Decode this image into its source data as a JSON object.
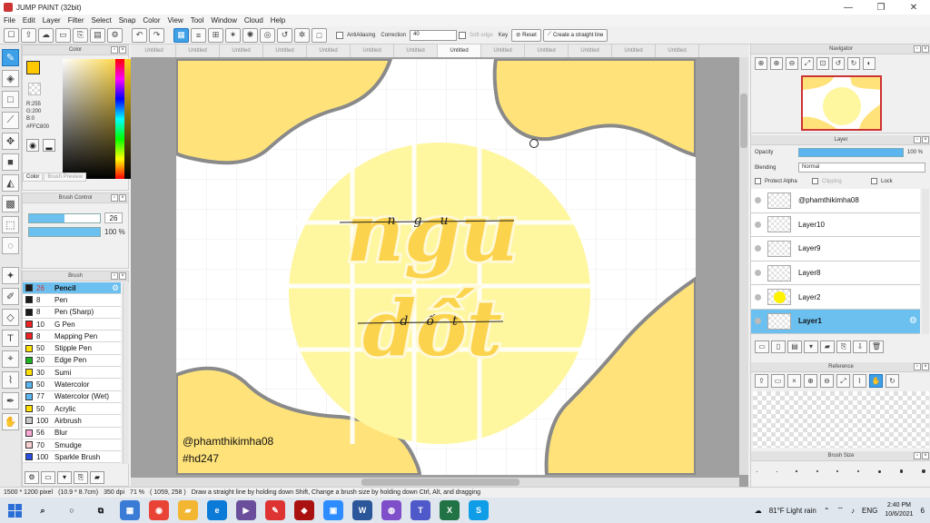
{
  "window": {
    "title": "JUMP PAINT (32bit)",
    "buttons": [
      "—",
      "❐",
      "✕"
    ]
  },
  "menu": [
    "File",
    "Edit",
    "Layer",
    "Filter",
    "Select",
    "Snap",
    "Color",
    "View",
    "Tool",
    "Window",
    "Cloud",
    "Help"
  ],
  "toolbar": {
    "antialiasing_label": "AntiAliasing",
    "correction_label": "Correction",
    "correction_value": "40",
    "soft_edge_label": "Soft edge",
    "key_label": "Key",
    "reset_label": "Reset",
    "straight_line_label": "Create a straight line"
  },
  "color_panel": {
    "title": "Color",
    "rgb": [
      "R:255",
      "G:200",
      "B:0"
    ],
    "hex": "#FFC800",
    "fg_color": "#ffc800",
    "tabs": [
      "Color",
      "Brush Preview"
    ]
  },
  "brush_control": {
    "title": "Brush Control",
    "size": "26",
    "opacity": "100 %"
  },
  "brush_panel": {
    "title": "Brush",
    "items": [
      {
        "size": "26",
        "name": "Pencil",
        "color": "#1a1a1a",
        "selected": true
      },
      {
        "size": "8",
        "name": "Pen",
        "color": "#1a1a1a"
      },
      {
        "size": "8",
        "name": "Pen (Sharp)",
        "color": "#1a1a1a"
      },
      {
        "size": "10",
        "name": "G Pen",
        "color": "#e22"
      },
      {
        "size": "8",
        "name": "Mapping Pen",
        "color": "#e22"
      },
      {
        "size": "50",
        "name": "Stipple Pen",
        "color": "#ffe000"
      },
      {
        "size": "20",
        "name": "Edge Pen",
        "color": "#22b522"
      },
      {
        "size": "30",
        "name": "Sumi",
        "color": "#ffe000"
      },
      {
        "size": "50",
        "name": "Watercolor",
        "color": "#5ab6f0"
      },
      {
        "size": "77",
        "name": "Watercolor (Wet)",
        "color": "#5ab6f0"
      },
      {
        "size": "50",
        "name": "Acrylic",
        "color": "#ffe000"
      },
      {
        "size": "100",
        "name": "Airbrush",
        "color": "#c8c8c8"
      },
      {
        "size": "56",
        "name": "Blur",
        "color": "#f9a8d4"
      },
      {
        "size": "70",
        "name": "Smudge",
        "color": "#f9d0d0"
      },
      {
        "size": "100",
        "name": "Sparkle Brush",
        "color": "#2a4fe0"
      }
    ]
  },
  "doc_tabs": [
    "Untitled",
    "Untitled",
    "Untitled",
    "Untitled",
    "Untitled",
    "Untitled",
    "Untitled",
    "Untitled",
    "Untitled",
    "Untitled",
    "Untitled",
    "Untitled",
    "Untitled"
  ],
  "active_doc_tab": 7,
  "artwork": {
    "title_line1": "ngu",
    "title_line2": "dốt",
    "script_line1": "ngu",
    "script_line2": "dốt",
    "watermark_user": "@phamthikimha08",
    "watermark_tag": "#hd247",
    "colors": {
      "blob": "#ffe37a",
      "circle": "#fff6a0",
      "outline": "#8a8a8a",
      "text": "#fcd34d"
    }
  },
  "navigator": {
    "title": "Navigator"
  },
  "layer_panel": {
    "title": "Layer",
    "opacity_label": "Opacity",
    "opacity_value": "100 %",
    "blending_label": "Blending",
    "blending_value": "Normal",
    "protect_alpha_label": "Protect Alpha",
    "clipping_label": "Clipping",
    "lock_label": "Lock",
    "layers": [
      {
        "name": "@phamthikimha08"
      },
      {
        "name": "Layer10"
      },
      {
        "name": "Layer9"
      },
      {
        "name": "Layer8"
      },
      {
        "name": "Layer2"
      },
      {
        "name": "Layer1",
        "selected": true
      }
    ]
  },
  "reference_panel": {
    "title": "Reference"
  },
  "brush_size_panel": {
    "title": "Brush Size"
  },
  "status": {
    "dimensions": "1500 * 1200 pixel",
    "physical": "(10.9 * 8.7cm)",
    "dpi": "350 dpi",
    "zoom": "71 %",
    "cursor": "( 1059, 258 )",
    "hint": "Draw a straight line by holding down Shift, Change a brush size by holding down Ctrl, Alt, and dragging"
  },
  "taskbar": {
    "weather": "81°F  Light rain",
    "language": "ENG",
    "time": "2:40 PM",
    "date": "10/6/2021",
    "notification_count": "6"
  }
}
